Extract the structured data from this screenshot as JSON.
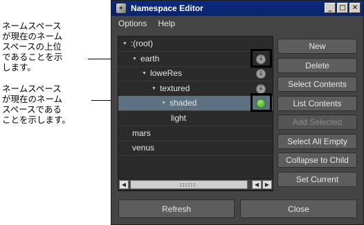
{
  "annotations": {
    "parent_note": "ネームスペース\nが現在のネーム\nスペースの上位\nであることを示\nします。",
    "current_note": "ネームスペース\nが現在のネーム\nスペースである\nことを示します。"
  },
  "window": {
    "title": "Namespace Editor",
    "icon": "maya-app-icon",
    "controls": {
      "minimize": "_",
      "maximize": "□",
      "close": "✕"
    }
  },
  "menu": {
    "items": [
      "Options",
      "Help"
    ]
  },
  "tree": {
    "rows": [
      {
        "label": ":(root)",
        "indent": 0,
        "expanded": true,
        "icon": null,
        "selected": false
      },
      {
        "label": "earth",
        "indent": 1,
        "expanded": true,
        "icon": "parent-of-current-icon",
        "selected": false
      },
      {
        "label": "loweRes",
        "indent": 2,
        "expanded": true,
        "icon": "parent-of-current-icon",
        "selected": false
      },
      {
        "label": "textured",
        "indent": 3,
        "expanded": true,
        "icon": "parent-of-current-icon",
        "selected": false
      },
      {
        "label": "shaded",
        "indent": 4,
        "expanded": true,
        "icon": "current-namespace-icon",
        "selected": true
      },
      {
        "label": "light",
        "indent": 5,
        "expanded": false,
        "icon": null,
        "selected": false
      },
      {
        "label": "mars",
        "indent": 1,
        "expanded": false,
        "icon": null,
        "selected": false
      },
      {
        "label": "venus",
        "indent": 1,
        "expanded": false,
        "icon": null,
        "selected": false
      }
    ],
    "expanded_glyph": "▼",
    "parent_glyph": "↓"
  },
  "buttons": {
    "new": "New",
    "delete": "Delete",
    "select_contents": "Select Contents",
    "list_contents": "List Contents",
    "add_selected": "Add Selected",
    "select_all_empty": "Select All Empty",
    "collapse_to_child": "Collapse to Child",
    "set_current": "Set Current",
    "refresh": "Refresh",
    "close": "Close"
  },
  "scrollbar": {
    "left": "◀",
    "right_a": "◀",
    "right_b": "▶"
  },
  "colors": {
    "window_bg": "#444444",
    "panel_bg": "#2b2b2b",
    "selection": "#5d7182",
    "titlebar": "#0a246a",
    "current_indicator": "#3f9a1f"
  }
}
